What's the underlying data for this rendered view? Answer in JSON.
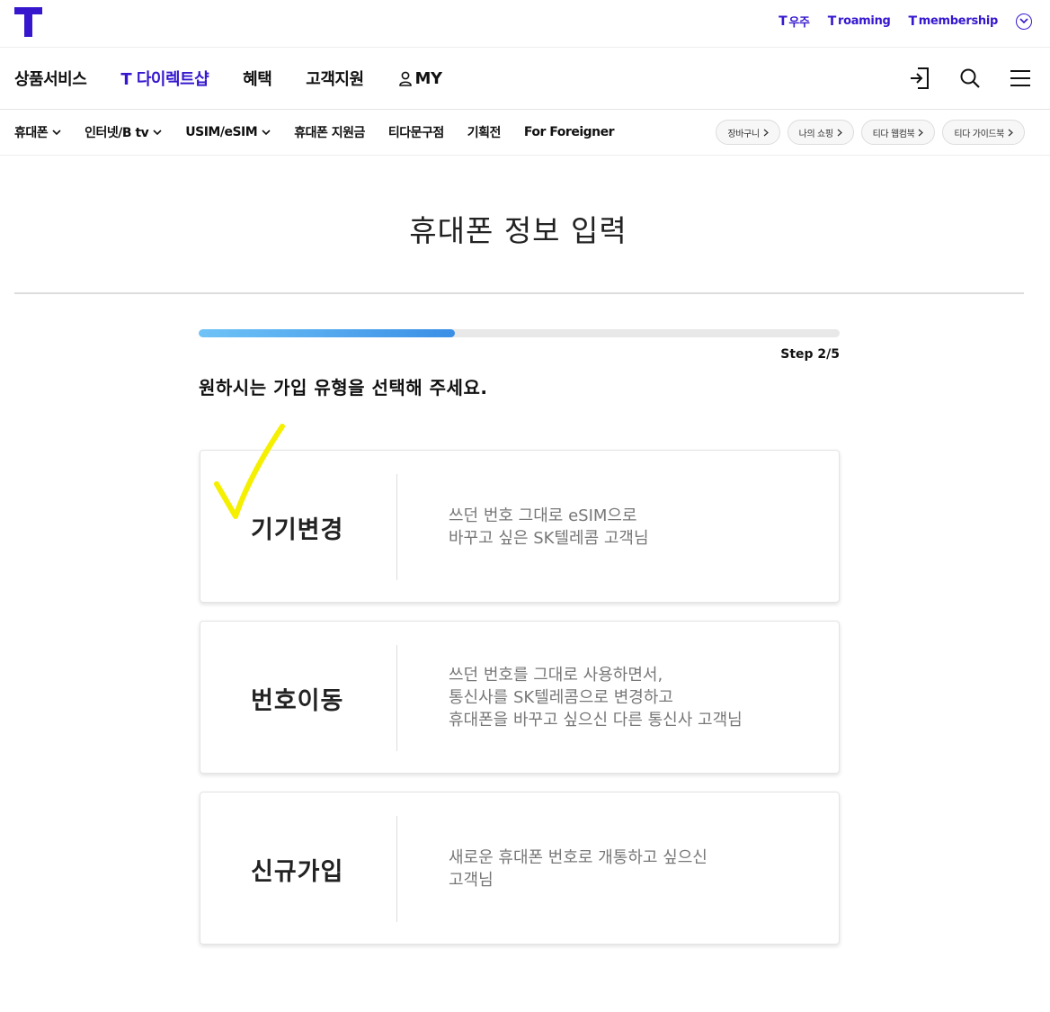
{
  "header": {
    "logo_letter": "T",
    "top_links": [
      {
        "mark": "T",
        "label": "우주"
      },
      {
        "mark": "T",
        "label": "roaming"
      },
      {
        "mark": "T",
        "label": "membership"
      }
    ]
  },
  "gnb": {
    "items": [
      "상품서비스",
      "T 다이렉트샵",
      "혜택",
      "고객지원",
      "MY"
    ]
  },
  "subnav": {
    "items": [
      "휴대폰",
      "인터넷/B tv",
      "USIM/eSIM",
      "휴대폰 지원금",
      "티다문구점",
      "기획전",
      "For Foreigner"
    ],
    "pills": [
      "장바구니",
      "나의 쇼핑",
      "티다 웹컴북",
      "티다 가이드북"
    ]
  },
  "page": {
    "title": "휴대폰 정보 입력",
    "step": "Step 2/5",
    "progress": 0.4,
    "question": "원하시는 가입 유형을 선택해 주세요."
  },
  "options": [
    {
      "title": "기기변경",
      "desc": [
        "쓰던 번호 그대로 eSIM으로",
        "바꾸고 싶은 SK텔레콤 고객님"
      ]
    },
    {
      "title": "번호이동",
      "desc": [
        "쓰던 번호를 그대로 사용하면서,",
        "통신사를 SK텔레콤으로 변경하고",
        "휴대폰을 바꾸고 싶으신 다른 통신사 고객님"
      ]
    },
    {
      "title": "신규가입",
      "desc": [
        "새로운 휴대폰 번호로 개통하고 싶으신",
        "고객님"
      ]
    }
  ],
  "colors": {
    "brand": "#3617ce",
    "progress_start": "#6fc3f7",
    "progress_end": "#3a8fe6",
    "annotation": "#f5ef00"
  }
}
